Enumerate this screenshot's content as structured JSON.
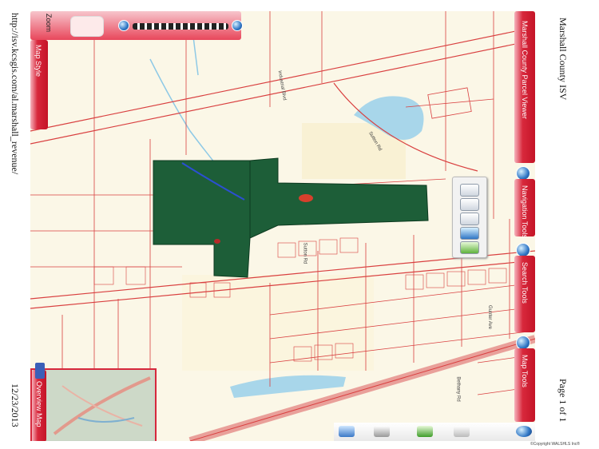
{
  "page": {
    "header_title": "Marshall County ISV",
    "url": "http://isv.kcsgis.com/al.marshall_revenue/",
    "page_number": "Page 1 of 1",
    "date": "12/23/2013"
  },
  "map": {
    "zoom_label": "Zoom",
    "map_style_label": "Map Style",
    "overview_label": "Overview Map",
    "title_panel": "Marshall County Parcel Viewer",
    "navigation_tools": "Navigation Tools",
    "search_tools": "Search Tools",
    "map_tools": "Map Tools",
    "copyright": "©Copyright WALSHLS Inc®",
    "street_labels": [
      "Industrial Blvd",
      "Sutton Rd",
      "Sutton Rd",
      "Gunter Ave",
      "Bethany Rd"
    ]
  },
  "colors": {
    "parcel_green": "#1d5e38",
    "panel_red": "#d22035",
    "road_red": "#d94040"
  }
}
